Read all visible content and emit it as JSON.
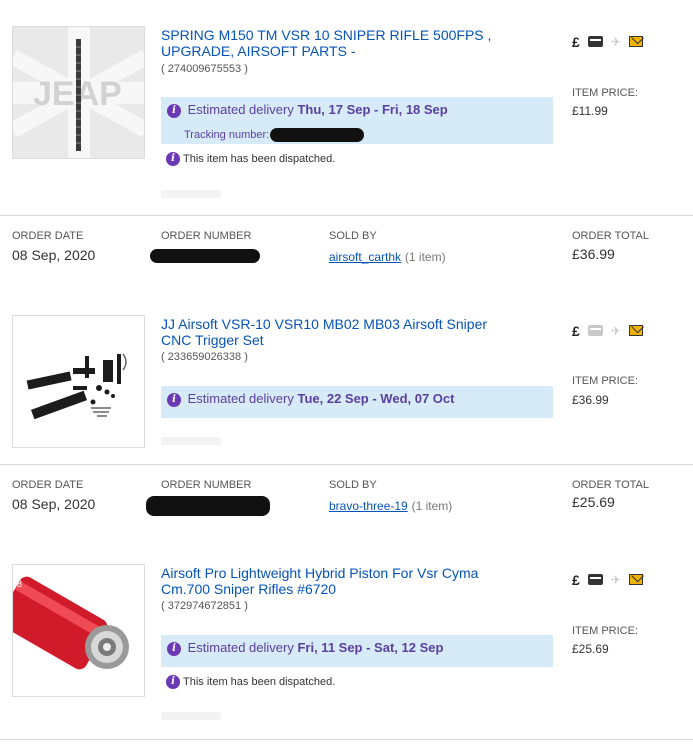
{
  "orders": [
    {
      "item": {
        "title": "SPRING M150 TM VSR 10 SNIPER RIFLE 500FPS , UPGRADE, AIRSOFT PARTS -",
        "item_id": "( 274009675553 )",
        "price_label": "ITEM PRICE:",
        "price": "£11.99",
        "icons": [
          "pound-icon",
          "payment-icon",
          "shipped-icon",
          "feedback-icon"
        ],
        "delivery_label": "Estimated delivery",
        "delivery_dates": "Thu, 17 Sep - Fri, 18 Sep",
        "tracking_label": "Tracking number:",
        "dispatch": "This item has been dispatched."
      }
    },
    {
      "header": {
        "date_label": "ORDER DATE",
        "date": "08 Sep, 2020",
        "number_label": "ORDER NUMBER",
        "sold_label": "SOLD BY",
        "seller": "airsoft_carthk",
        "count": "(1 item)",
        "total_label": "ORDER TOTAL",
        "total": "£36.99"
      },
      "item": {
        "title": "JJ Airsoft VSR-10 VSR10 MB02 MB03 Airsoft Sniper CNC Trigger Set",
        "item_id": "( 233659026338 )",
        "price_label": "ITEM PRICE:",
        "price": "£36.99",
        "icons": [
          "pound-icon",
          "payment-icon",
          "shipped-icon",
          "feedback-icon"
        ],
        "delivery_label": "Estimated delivery",
        "delivery_dates": "Tue, 22 Sep - Wed, 07 Oct"
      }
    },
    {
      "header": {
        "date_label": "ORDER DATE",
        "date": "08 Sep, 2020",
        "number_label": "ORDER NUMBER",
        "sold_label": "SOLD BY",
        "seller": "bravo-three-19",
        "count": "(1 item)",
        "total_label": "ORDER TOTAL",
        "total": "£25.69"
      },
      "item": {
        "title": "Airsoft Pro Lightweight Hybrid Piston For Vsr Cyma Cm.700 Sniper Rifles #6720",
        "item_id": "( 372974672851 )",
        "price_label": "ITEM PRICE:",
        "price": "£25.69",
        "icons": [
          "pound-icon",
          "payment-icon",
          "shipped-icon",
          "feedback-icon"
        ],
        "delivery_label": "Estimated delivery",
        "delivery_dates": "Fri, 11 Sep - Sat, 12 Sep",
        "dispatch": "This item has been dispatched."
      }
    }
  ],
  "glyphs": {
    "pound": "£",
    "info": "i",
    "ship": "✈"
  },
  "colors": {
    "link": "#0654ba",
    "delivery_bg": "#d6ebf7",
    "info": "#6b39b4"
  }
}
